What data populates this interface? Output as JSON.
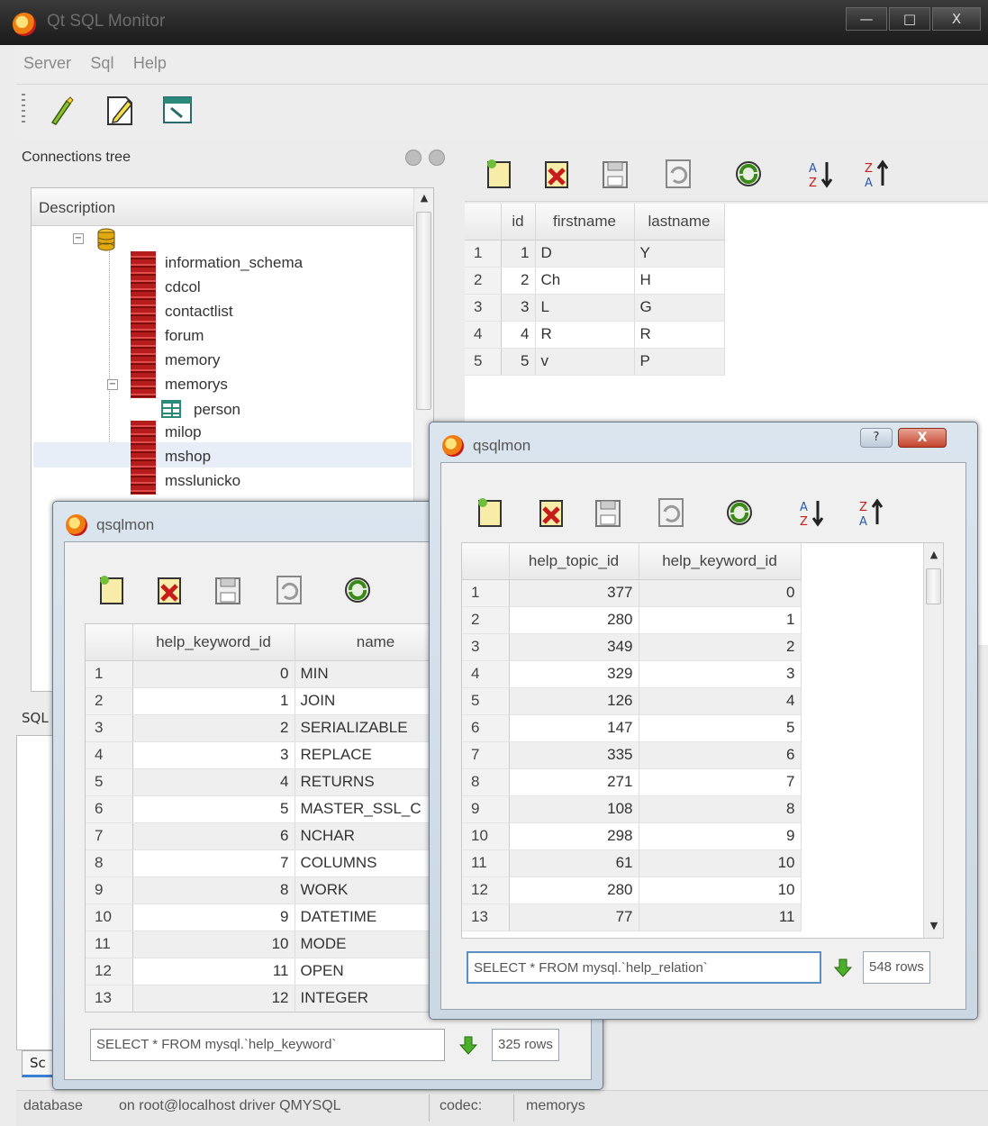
{
  "app": {
    "title": "Qt SQL Monitor",
    "win_min": "—",
    "win_max": "□",
    "win_close": "X"
  },
  "menu": [
    "Server",
    "Sql",
    "Help"
  ],
  "toolbar": [
    "connect-icon",
    "edit-query-icon",
    "new-window-icon"
  ],
  "connections": {
    "title": "Connections tree",
    "header": "Description",
    "databases": [
      "information_schema",
      "cdcol",
      "contactlist",
      "forum",
      "memory",
      "memorys"
    ],
    "table_under_memorys": "person",
    "more_databases": [
      "milop",
      "mshop",
      "msslunicko"
    ]
  },
  "grid_toolbar": [
    "new-row-icon",
    "delete-row-icon",
    "save-icon",
    "revert-icon",
    "refresh-icon",
    "sort-asc-icon",
    "sort-desc-icon"
  ],
  "person_grid": {
    "columns": [
      "id",
      "firstname",
      "lastname"
    ],
    "rows": [
      [
        "1",
        "1",
        "D",
        "Y"
      ],
      [
        "2",
        "2",
        "Ch",
        "H"
      ],
      [
        "3",
        "3",
        "L",
        "G"
      ],
      [
        "4",
        "4",
        "R",
        "R"
      ],
      [
        "5",
        "5",
        "v",
        "P"
      ]
    ]
  },
  "dialog_keyword": {
    "title": "qsqlmon",
    "columns": [
      "help_keyword_id",
      "name"
    ],
    "rows": [
      [
        "1",
        "0",
        "MIN"
      ],
      [
        "2",
        "1",
        "JOIN"
      ],
      [
        "3",
        "2",
        "SERIALIZABLE"
      ],
      [
        "4",
        "3",
        "REPLACE"
      ],
      [
        "5",
        "4",
        "RETURNS"
      ],
      [
        "6",
        "5",
        "MASTER_SSL_C"
      ],
      [
        "7",
        "6",
        "NCHAR"
      ],
      [
        "8",
        "7",
        "COLUMNS"
      ],
      [
        "9",
        "8",
        "WORK"
      ],
      [
        "10",
        "9",
        "DATETIME"
      ],
      [
        "11",
        "10",
        "MODE"
      ],
      [
        "12",
        "11",
        "OPEN"
      ],
      [
        "13",
        "12",
        "INTEGER"
      ]
    ],
    "query": "SELECT * FROM mysql.`help_keyword`",
    "row_count": "325 rows"
  },
  "dialog_relation": {
    "title": "qsqlmon",
    "help": "?",
    "close": "X",
    "columns": [
      "help_topic_id",
      "help_keyword_id"
    ],
    "rows": [
      [
        "1",
        "377",
        "0"
      ],
      [
        "2",
        "280",
        "1"
      ],
      [
        "3",
        "349",
        "2"
      ],
      [
        "4",
        "329",
        "3"
      ],
      [
        "5",
        "126",
        "4"
      ],
      [
        "6",
        "147",
        "5"
      ],
      [
        "7",
        "335",
        "6"
      ],
      [
        "8",
        "271",
        "7"
      ],
      [
        "9",
        "108",
        "8"
      ],
      [
        "10",
        "298",
        "9"
      ],
      [
        "11",
        "61",
        "10"
      ],
      [
        "12",
        "280",
        "10"
      ],
      [
        "13",
        "77",
        "11"
      ]
    ],
    "query": "SELECT * FROM mysql.`help_relation`",
    "row_count": "548 rows"
  },
  "sql_panel": {
    "label": "SQL",
    "tab": "Sc"
  },
  "status": {
    "database": "database",
    "connection": "on root@localhost driver QMYSQL",
    "codec": "codec:",
    "current_db": "memorys"
  },
  "colors": {
    "accent": "#3a7fd0",
    "db_icon": "#b51c1c",
    "dialog_frame": "#cbd7e2"
  }
}
